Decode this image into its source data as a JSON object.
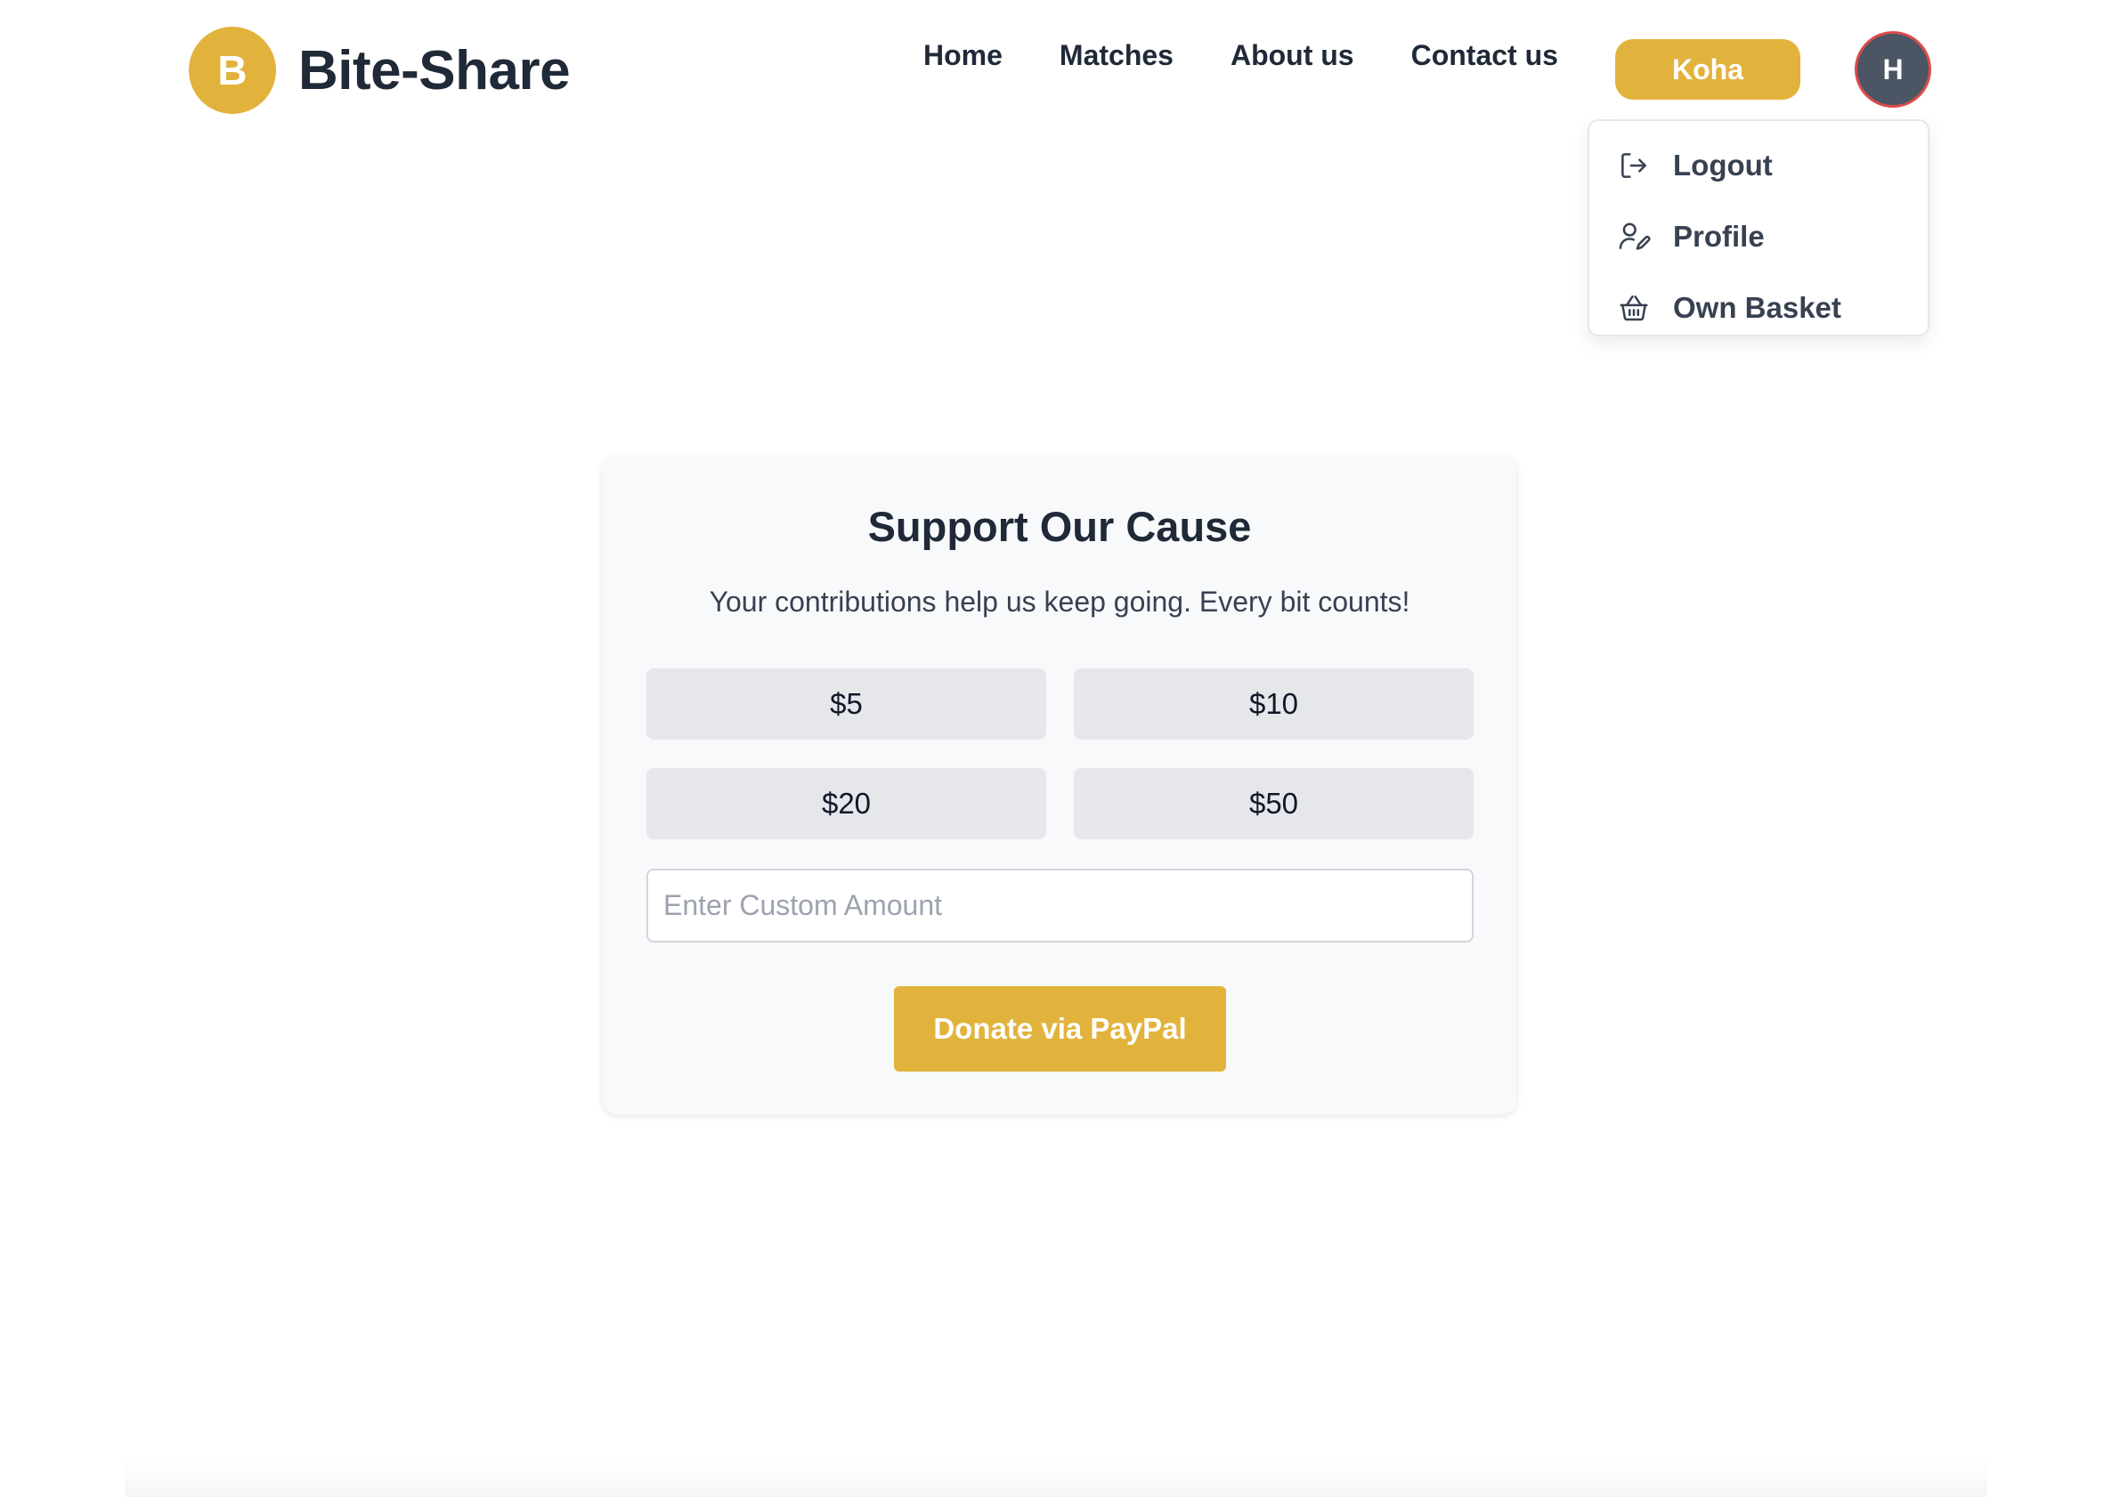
{
  "brand": {
    "logo_letter": "B",
    "name": "Bite-Share",
    "accent_color": "#e2b33c"
  },
  "nav": {
    "links": [
      {
        "label": "Home"
      },
      {
        "label": "Matches"
      },
      {
        "label": "About us"
      },
      {
        "label": "Contact us"
      }
    ],
    "koha_label": "Koha",
    "avatar_letter": "H"
  },
  "user_menu": {
    "items": [
      {
        "label": "Logout",
        "icon": "logout-icon"
      },
      {
        "label": "Profile",
        "icon": "profile-edit-icon"
      },
      {
        "label": "Own Basket",
        "icon": "basket-icon"
      }
    ]
  },
  "donation": {
    "title": "Support Our Cause",
    "subtitle": "Your contributions help us keep going. Every bit counts!",
    "amounts": [
      {
        "label": "$5"
      },
      {
        "label": "$10"
      },
      {
        "label": "$20"
      },
      {
        "label": "$50"
      }
    ],
    "custom_amount": {
      "value": "",
      "placeholder": "Enter Custom Amount"
    },
    "donate_label": "Donate via PayPal"
  }
}
